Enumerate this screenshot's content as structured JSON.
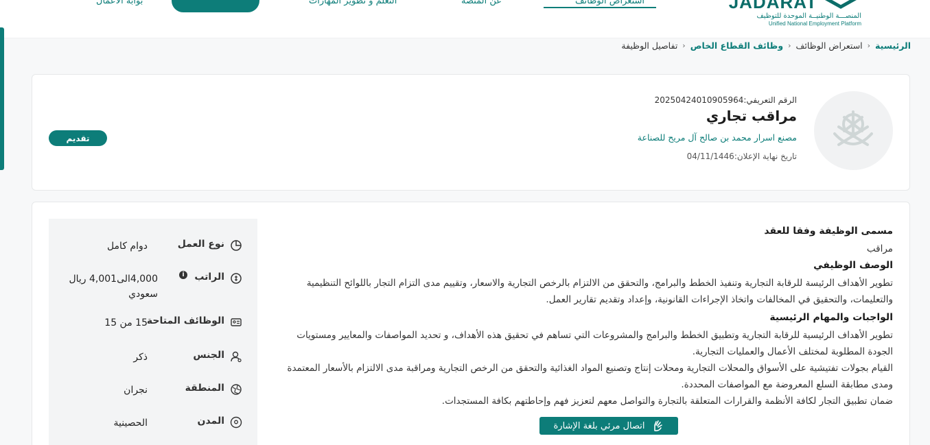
{
  "header": {
    "logo_text": "JADARAT",
    "logo_ar": "المنصـــة الوطنيــة الموحدة للتوظيف",
    "logo_en": "Unified National Employment Platform",
    "nav": [
      "استعراض الوظائف",
      "عن المنصة",
      "التعلم و تطوير المهارات",
      "بوابة الأعمال"
    ]
  },
  "breadcrumb": {
    "home": "الرئيسية",
    "jobs": "استعراض الوظائف",
    "private": "وظائف القطاع الخاص",
    "current": "تفاصيل الوظيفة"
  },
  "job": {
    "id_text": "الرقم التعريفي:20250424010905964",
    "title": "مراقب تجاري",
    "company": "مصنع اسرار محمد بن صالح آل مريح للصناعة",
    "deadline": "تاريخ نهاية الإعلان:04/11/1446",
    "apply_label": "تقديم"
  },
  "attributes": [
    {
      "label": "نوع العمل",
      "value": "دوام كامل",
      "icon": "pie-chart-icon"
    },
    {
      "label": "الراتب",
      "value": "4,000الى4,001 ريال سعودي",
      "icon": "money-icon",
      "info": "i"
    },
    {
      "label": "الوظائف المتاحة",
      "value": "15 من 15",
      "icon": "id-card-icon"
    },
    {
      "label": "الجنس",
      "value": "ذكر",
      "icon": "user-icon"
    },
    {
      "label": "المنطقة",
      "value": "نجران",
      "icon": "map-icon"
    },
    {
      "label": "المدن",
      "value": "الحصينية",
      "icon": "location-pin-icon"
    }
  ],
  "content": {
    "contract_title_head": "مسمى الوظيفة وفقا للعقد",
    "contract_title": "مراقب",
    "description_head": "الوصف الوظيفي",
    "description": "تطوير الأهداف الرئيسة للرقابة التجارية وتنفيذ الخطط والبرامج، والتحقق من الالتزام بالرخص التجارية والاسعار، وتقييم مدى التزام التجار باللوائح التنظيمية والتعليمات، والتحقيق في المخالفات واتخاذ الإجراءات القانونية، وإعداد وتقديم تقارير العمل.",
    "duties_head": "الواجبات والمهام الرئيسية",
    "duties": [
      "تطوير الأهداف الرئيسية للرقابة التجارية وتطبيق الخطط والبرامج والمشروعات التي تساهم في تحقيق هذه الأهداف، و تحديد المواصفات والمعايير ومستويات الجودة المطلوبة لمختلف الأعمال والعمليات التجارية.",
      "القيام بجولات تفتيشية على الأسواق والمحلات التجارية ومحلات إنتاج وتصنيع المواد الغذائية والتحقق من الرخص التجارية ومراقبة مدى الالتزام بالأسعار المعتمدة ومدى مطابقة السلع المعروضة مع المواصفات المحددة.",
      "ضمان تطبيق التجار لكافة الأنظمة والقرارات المتعلقة بالتجارة والتواصل معهم لتعزيز فهم وإحاطتهم بكافة المستجدات."
    ]
  },
  "sign_language_label": "اتصال مرئي بلغة الإشارة",
  "colors": {
    "accent": "#0d7d79"
  }
}
